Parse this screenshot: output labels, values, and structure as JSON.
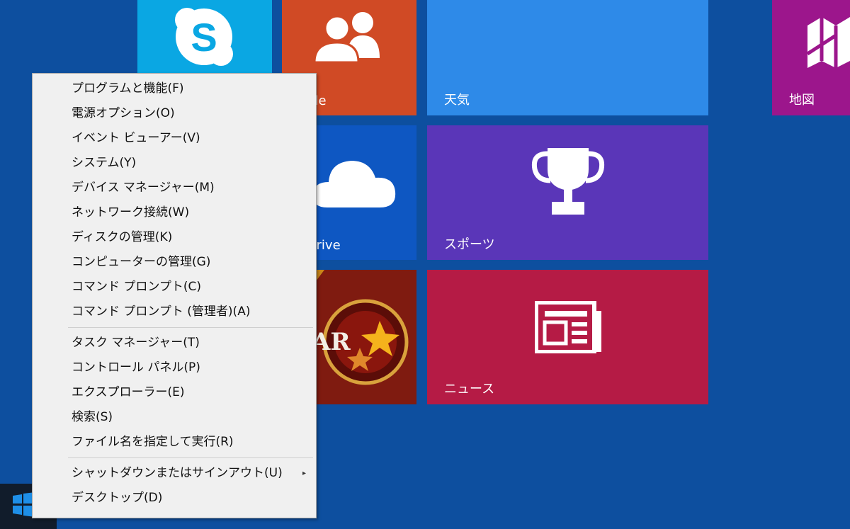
{
  "tiles": {
    "skype": {
      "label": ""
    },
    "people": {
      "label": "ople"
    },
    "weather": {
      "label": "天気"
    },
    "maps": {
      "label": "地図"
    },
    "onedrive": {
      "label": "yDrive"
    },
    "sports": {
      "label": "スポーツ"
    },
    "game": {
      "text": "AR"
    },
    "news": {
      "label": "ニュース"
    }
  },
  "menu": {
    "group1": [
      "プログラムと機能(F)",
      "電源オプション(O)",
      "イベント ビューアー(V)",
      "システム(Y)",
      "デバイス マネージャー(M)",
      "ネットワーク接続(W)",
      "ディスクの管理(K)",
      "コンピューターの管理(G)",
      "コマンド プロンプト(C)",
      "コマンド プロンプト (管理者)(A)"
    ],
    "group2": [
      "タスク マネージャー(T)",
      "コントロール パネル(P)",
      "エクスプローラー(E)",
      "検索(S)",
      "ファイル名を指定して実行(R)"
    ],
    "group3": [
      "シャットダウンまたはサインアウト(U)",
      "デスクトップ(D)"
    ],
    "submenu_arrow": "▸"
  }
}
